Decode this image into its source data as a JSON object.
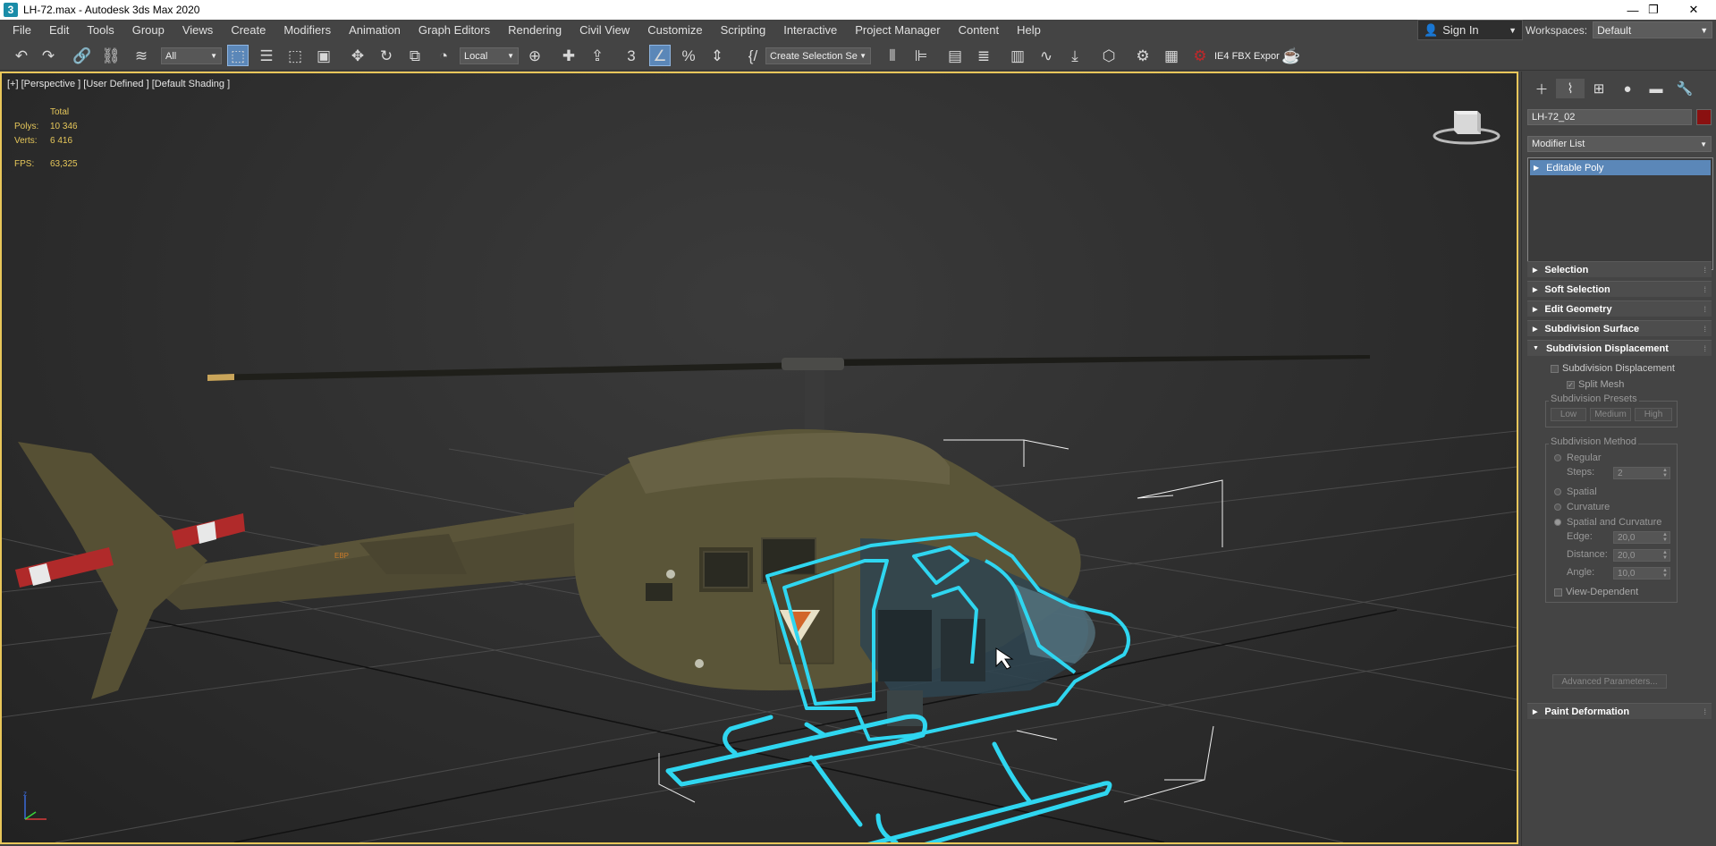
{
  "window": {
    "title": "LH-72.max - Autodesk 3ds Max 2020",
    "app_icon_glyph": "3"
  },
  "menu": [
    "File",
    "Edit",
    "Tools",
    "Group",
    "Views",
    "Create",
    "Modifiers",
    "Animation",
    "Graph Editors",
    "Rendering",
    "Civil View",
    "Customize",
    "Scripting",
    "Interactive",
    "Project Manager",
    "Content",
    "Help"
  ],
  "account": {
    "sign_in": "Sign In"
  },
  "workspaces": {
    "label": "Workspaces:",
    "value": "Default"
  },
  "toolbar": {
    "selection_filter": "All",
    "reference_coord": "Local",
    "named_selection_set": "Create Selection Se",
    "fbx_export_label": "IE4 FBX Expor"
  },
  "viewport": {
    "label": "[+] [Perspective ] [User Defined ] [Default Shading ]",
    "stats": {
      "header": "Total",
      "polys_label": "Polys:",
      "polys_value": "10 346",
      "verts_label": "Verts:",
      "verts_value": "6 416",
      "fps_label": "FPS:",
      "fps_value": "63,325"
    },
    "helicopter_decal": "ЕВР",
    "colors": {
      "selection_outline": "#2fd6f0",
      "active_border": "#e8c65a",
      "stats_text": "#e6c75a"
    }
  },
  "command_panel": {
    "object_name": "LH-72_02",
    "object_color": "#8a1010",
    "modifier_list": "Modifier List",
    "stack": [
      "Editable Poly"
    ],
    "rollouts": {
      "selection": "Selection",
      "soft_selection": "Soft Selection",
      "edit_geometry": "Edit Geometry",
      "subdivision_surface": "Subdivision Surface",
      "subdivision_displacement": "Subdivision Displacement",
      "paint_deformation": "Paint Deformation"
    },
    "subdivision_displacement": {
      "enable_label": "Subdivision Displacement",
      "split_mesh_label": "Split Mesh",
      "presets_title": "Subdivision Presets",
      "preset_low": "Low",
      "preset_medium": "Medium",
      "preset_high": "High",
      "method_title": "Subdivision Method",
      "regular": "Regular",
      "steps_label": "Steps:",
      "steps_value": "2",
      "spatial": "Spatial",
      "curvature": "Curvature",
      "spatial_curvature": "Spatial and Curvature",
      "edge_label": "Edge:",
      "edge_value": "20,0",
      "distance_label": "Distance:",
      "distance_value": "20,0",
      "angle_label": "Angle:",
      "angle_value": "10,0",
      "view_dependent": "View-Dependent",
      "advanced": "Advanced Parameters..."
    }
  }
}
